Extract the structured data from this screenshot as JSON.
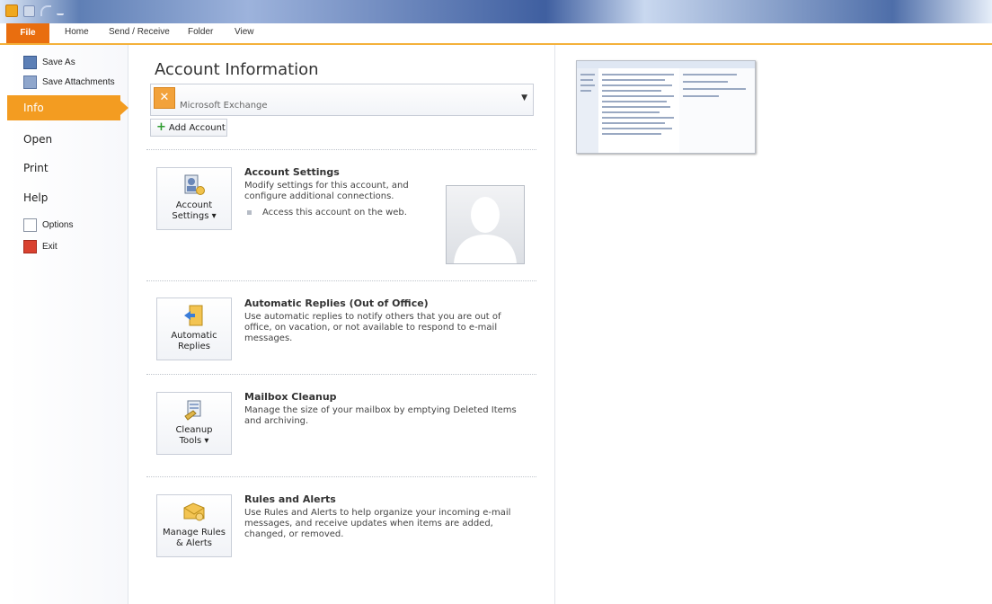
{
  "tabs": [
    {
      "label": "File"
    },
    {
      "label": "Home"
    },
    {
      "label": "Send / Receive"
    },
    {
      "label": "Folder"
    },
    {
      "label": "View"
    }
  ],
  "nav": {
    "save_as": "Save As",
    "save_attachments": "Save Attachments",
    "info": "Info",
    "open": "Open",
    "print": "Print",
    "help": "Help",
    "options": "Options",
    "exit": "Exit"
  },
  "info": {
    "title": "Account Information",
    "account_name": "Microsoft Exchange",
    "add_account": "Add Account",
    "sections": [
      {
        "button_line1": "Account",
        "button_line2": "Settings ▾",
        "heading": "Account Settings",
        "desc": "Modify settings for this account, and configure additional connections.",
        "bullet": "Access this account on the web."
      },
      {
        "button_line1": "Automatic",
        "button_line2": "Replies",
        "heading": "Automatic Replies (Out of Office)",
        "desc": "Use automatic replies to notify others that you are out of office, on vacation, or not available to respond to e-mail messages."
      },
      {
        "button_line1": "Cleanup",
        "button_line2": "Tools ▾",
        "heading": "Mailbox Cleanup",
        "desc": "Manage the size of your mailbox by emptying Deleted Items and archiving."
      },
      {
        "button_line1": "Manage Rules",
        "button_line2": "& Alerts",
        "heading": "Rules and Alerts",
        "desc": "Use Rules and Alerts to help organize your incoming e-mail messages, and receive updates when items are added, changed, or removed."
      }
    ]
  },
  "icons": {
    "app": "outlook-icon",
    "save": "save-icon",
    "undo": "undo-icon",
    "customize": "qat-dropdown-icon",
    "save_as": "save-as-icon",
    "attachments": "save-attachments-icon",
    "options": "options-icon",
    "exit": "exit-icon",
    "exchange": "exchange-icon",
    "add": "plus-icon",
    "settings": "account-settings-icon",
    "replies": "automatic-replies-icon",
    "cleanup": "cleanup-tools-icon",
    "rules": "rules-alerts-icon",
    "avatar": "person-placeholder-icon"
  },
  "colors": {
    "file_tab": "#e96e0f",
    "info_selected": "#f39c21",
    "accent_line": "#f4b13b"
  }
}
